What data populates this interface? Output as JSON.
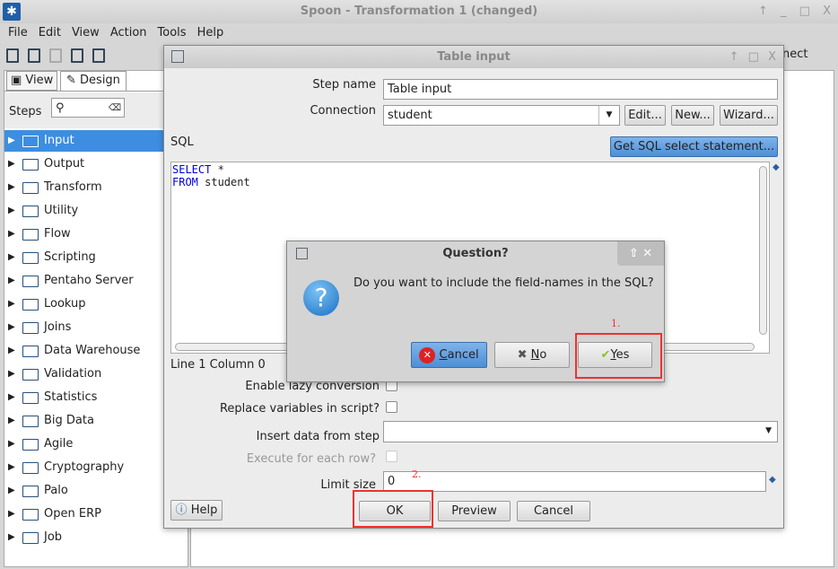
{
  "window": {
    "title": "Spoon - Transformation 1 (changed)",
    "controls": [
      "↑",
      "_",
      "□",
      "X"
    ]
  },
  "menu": [
    "File",
    "Edit",
    "View",
    "Action",
    "Tools",
    "Help"
  ],
  "toolbar": {
    "partial_label": "nect"
  },
  "left_panel": {
    "tabs": [
      "View",
      "Design"
    ],
    "steps_label": "Steps",
    "tree": [
      "Input",
      "Output",
      "Transform",
      "Utility",
      "Flow",
      "Scripting",
      "Pentaho Server",
      "Lookup",
      "Joins",
      "Data Warehouse",
      "Validation",
      "Statistics",
      "Big Data",
      "Agile",
      "Cryptography",
      "Palo",
      "Open ERP",
      "Job"
    ],
    "selected": "Input"
  },
  "dialog": {
    "title": "Table input",
    "step_name_label": "Step name",
    "step_name_value": "Table input",
    "connection_label": "Connection",
    "connection_value": "student",
    "edit": "Edit...",
    "new": "New...",
    "wizard": "Wizard...",
    "sql_label": "SQL",
    "get_sql": "Get SQL select statement...",
    "sql_lines": [
      {
        "kw": "SELECT",
        "rest": " *"
      },
      {
        "kw": "FROM",
        "rest": " student"
      }
    ],
    "position": "Line 1 Column 0",
    "lazy": "Enable lazy conversion",
    "replace_vars": "Replace variables in script?",
    "insert_from": "Insert data from step",
    "exec_each": "Execute for each row?",
    "limit_label": "Limit size",
    "limit_value": "0",
    "help": "Help",
    "ok": "OK",
    "preview": "Preview",
    "cancel": "Cancel"
  },
  "question": {
    "title": "Question?",
    "message": "Do you want to include the field-names in the SQL?",
    "cancel": "ancel",
    "cancel_u": "C",
    "no": "o",
    "no_u": "N",
    "yes": "es",
    "yes_u": "Y"
  },
  "annotations": {
    "step1": "1.",
    "step2": "2.",
    "color": "#f03030"
  }
}
